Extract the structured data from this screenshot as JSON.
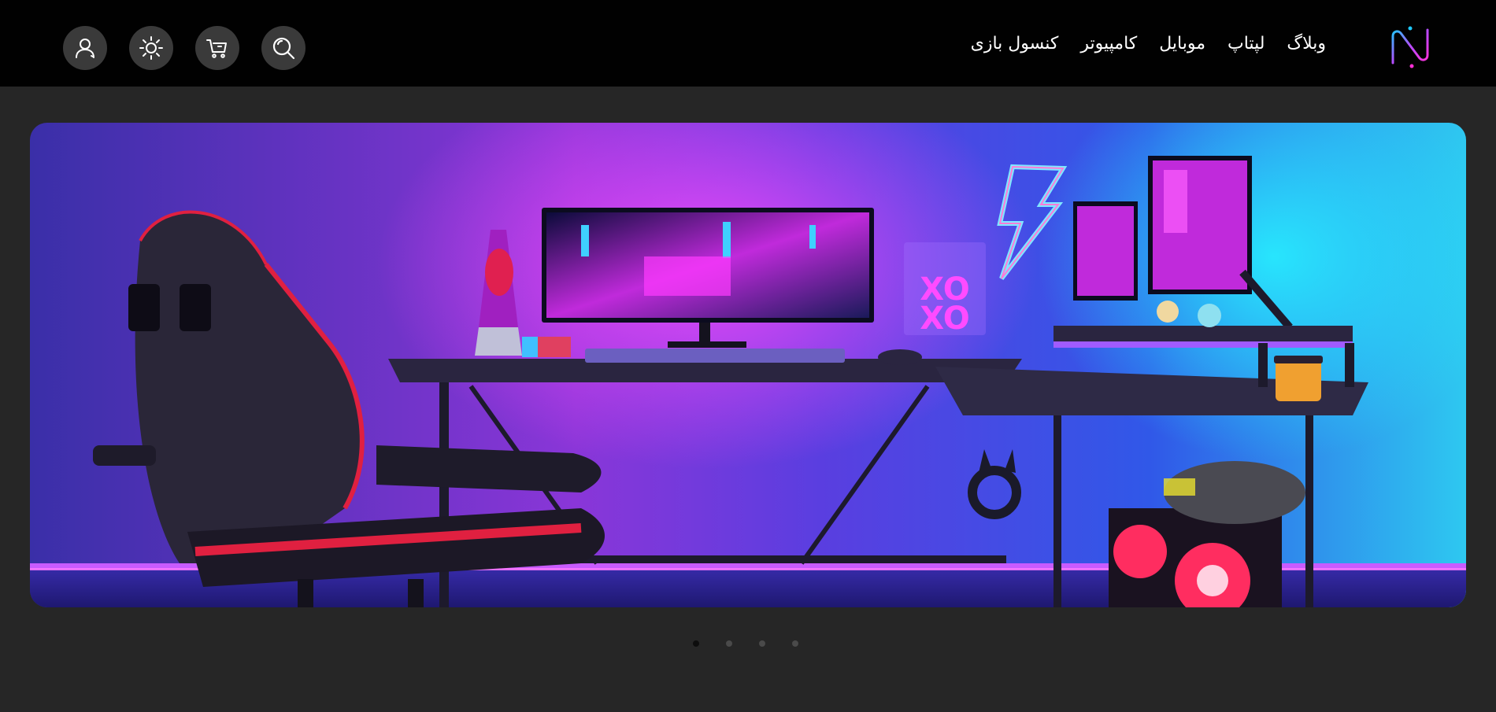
{
  "header": {
    "nav": [
      {
        "label": "کنسول بازی"
      },
      {
        "label": "کامپیوتر"
      },
      {
        "label": "موبایل"
      },
      {
        "label": "لپتاپ"
      },
      {
        "label": "وبلاگ"
      }
    ],
    "icons": {
      "user": "user-icon",
      "theme": "sun-icon",
      "cart": "cart-icon",
      "search": "search-icon",
      "logo": "brand-logo"
    }
  },
  "hero": {
    "image": "gaming-setup-neon-illustration",
    "slides_total": 4,
    "active_slide": 1
  },
  "colors": {
    "header_bg": "#010101",
    "page_bg": "#262626",
    "icon_button_bg": "#3a3a3a",
    "logo_pink": "#ff2fd6",
    "logo_cyan": "#1ec9ff",
    "neon_magenta": "#d63cff",
    "neon_cyan": "#1fd8ff"
  }
}
